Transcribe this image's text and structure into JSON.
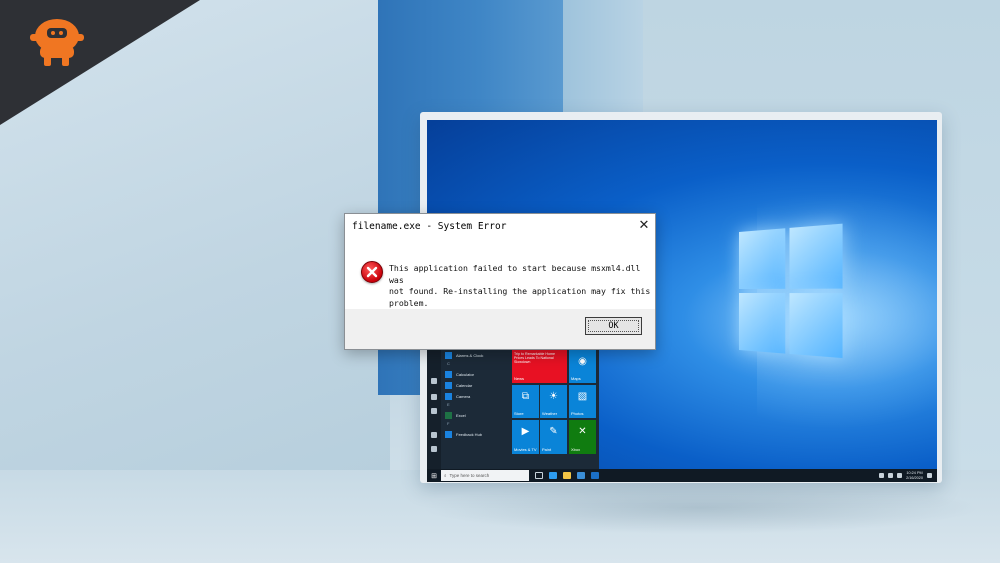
{
  "dialog": {
    "title": "filename.exe - System Error",
    "close_glyph": "✕",
    "message_line1": "This application failed to start because msxml4.dll was",
    "message_line2": "not found. Re-installing the application may fix this problem.",
    "ok_label": "OK",
    "icon": "error-icon"
  },
  "start_menu": {
    "apps": [
      {
        "type": "app",
        "label": "Alarms & Clock"
      },
      {
        "type": "letter",
        "label": "C"
      },
      {
        "type": "app",
        "label": "Calculator"
      },
      {
        "type": "app",
        "label": "Calendar"
      },
      {
        "type": "app",
        "label": "Camera"
      },
      {
        "type": "letter",
        "label": "E"
      },
      {
        "type": "app",
        "label": "Excel"
      },
      {
        "type": "letter",
        "label": "F"
      },
      {
        "type": "app",
        "label": "Feedback Hub"
      }
    ],
    "tiles": [
      {
        "label": "News",
        "symbol": "",
        "color": "#e81123",
        "headline": "Trip to Remarkable Home Prices Leads To National Slowdown"
      },
      {
        "label": "Maps",
        "symbol": "◉",
        "color": "#0a84d8"
      },
      {
        "label": "Store",
        "symbol": "⧉",
        "color": "#0a84d8"
      },
      {
        "label": "Weather",
        "symbol": "☀",
        "color": "#0a84d8"
      },
      {
        "label": "Photos",
        "symbol": "▧",
        "color": "#0a84d8"
      },
      {
        "label": "Movies & TV",
        "symbol": "▶",
        "color": "#0a84d8"
      },
      {
        "label": "Paint",
        "symbol": "✎",
        "color": "#0a84d8"
      },
      {
        "label": "Xbox",
        "symbol": "✕",
        "color": "#107c10"
      }
    ]
  },
  "taskbar": {
    "search_placeholder": "Type here to search",
    "time": "10:24 PM",
    "date": "2/16/2020"
  },
  "colors": {
    "desktop_blue": "#0a5fc8",
    "error_red": "#c8000a",
    "logo_orange": "#f07622",
    "logo_bg": "#2e3035"
  }
}
